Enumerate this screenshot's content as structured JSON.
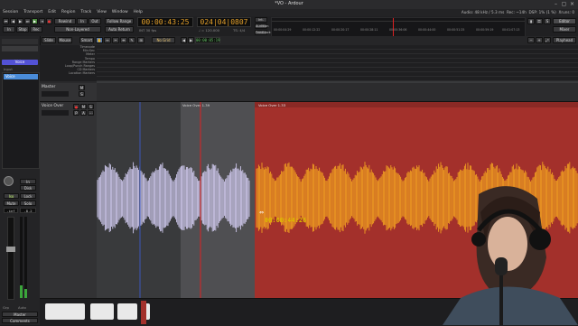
{
  "window": {
    "title": "*VO - Ardour"
  },
  "menu": [
    "Session",
    "Transport",
    "Edit",
    "Region",
    "Track",
    "View",
    "Window",
    "Help"
  ],
  "status": {
    "audio": "Audio: 48 kHz / 5.3 ms",
    "rec": "Rec: ~14h",
    "dsp": "DSP: 1% (1 %)",
    "xrun": "Xruns: 0"
  },
  "transport": {
    "follow_range": "Follow Range",
    "auto_return": "Auto Return",
    "stop": "Stop",
    "rec": "Rec",
    "non_layered": "Non-Layered",
    "punch_in": "In",
    "punch_out": "Out",
    "rewind_label": "Rewind",
    "primary_clock": "00:00:43:25",
    "secondary_clock": "024|04|0807",
    "clock_sub": "INT 30 fps",
    "clock_sub2": "TS: 4/4",
    "bpm": "♩ = 120.000",
    "int_btn": "Int.",
    "solo_btn": "Solo",
    "audition": "Audition",
    "feedback": "Feedback"
  },
  "mini_timeline": [
    "00:00:04:29",
    "00:00:12:22",
    "00:00:20:17",
    "00:00:28:11",
    "00:00:36:06",
    "00:00:44:00",
    "00:00:51:25",
    "00:00:59:19",
    "00:01:07:13"
  ],
  "edit_toolbar": {
    "slide": "Slide",
    "mouse": "Mouse",
    "smart": "Smart",
    "grid_label": "No Grid",
    "nudge_clock": "00:00:05:19",
    "playhead_btn": "Playhead",
    "editor_btn": "Editor",
    "mixer_btn": "Mixer"
  },
  "rulers": [
    "Timecode",
    "Min:Sec",
    "Meter",
    "Tempo",
    "Range Markers",
    "Loop/Punch Ranges",
    "CD Markers",
    "Location Markers"
  ],
  "tracks": [
    {
      "name": "Master",
      "m": "M",
      "s": "S"
    },
    {
      "name": "Voice Over",
      "m": "M",
      "s": "S",
      "p": "P",
      "a": "A"
    }
  ],
  "regions": [
    {
      "name": "Voice Over 1.39",
      "color": "#4f4f52"
    },
    {
      "name": "Voice Over 1.33",
      "color": "#a3302b"
    }
  ],
  "drag_timecode": "00:00:44:26",
  "leftstrip": {
    "selected_track": "Voice",
    "btn_in": "In",
    "btn_disk": "Disk",
    "btn_iso": "Iso",
    "btn_lock": "Lock",
    "btn_mute": "Mute",
    "btn_solo": "Solo",
    "gain_l": "-inf",
    "gain_r": "-8.2",
    "fader_mode": "Manual",
    "comments": "Comments",
    "plugin": "Voice",
    "in_label": "Input",
    "out_label": "Master",
    "grp_label": "Grp",
    "auto_label": "Auto"
  },
  "colors": {
    "accent": "#e4a02a",
    "region_red": "#a3302b",
    "wave_orange": "#f0a020",
    "wave_lilac": "#cfc9ee",
    "playhead": "#d22"
  }
}
